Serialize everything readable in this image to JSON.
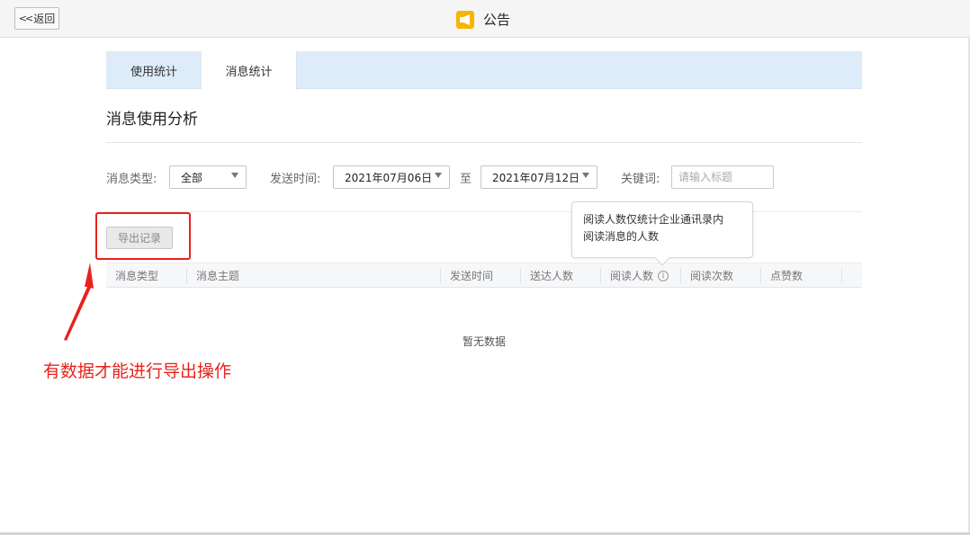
{
  "header": {
    "back_label": "返回",
    "title": "公告",
    "icon": "megaphone-icon",
    "icon_color": "#f7b500"
  },
  "tabs": [
    {
      "label": "使用统计",
      "active": false
    },
    {
      "label": "消息统计",
      "active": true
    }
  ],
  "section_title": "消息使用分析",
  "filters": {
    "type_label": "消息类型:",
    "type_value": "全部",
    "time_label": "发送时间:",
    "start_date": "2021年07月06日",
    "range_sep": "至",
    "end_date": "2021年07月12日",
    "keyword_label": "关键词:",
    "keyword_placeholder": "请输入标题",
    "keyword_value": ""
  },
  "tooltip": {
    "line1": "阅读人数仅统计企业通讯录内",
    "line2": "阅读消息的人数"
  },
  "export_label": "导出记录",
  "table": {
    "columns": [
      "消息类型",
      "消息主题",
      "发送时间",
      "送达人数",
      "阅读人数",
      "阅读次数",
      "点赞数"
    ],
    "empty_text": "暂无数据"
  },
  "annotation": {
    "text": "有数据才能进行导出操作",
    "color": "#e8221c"
  }
}
